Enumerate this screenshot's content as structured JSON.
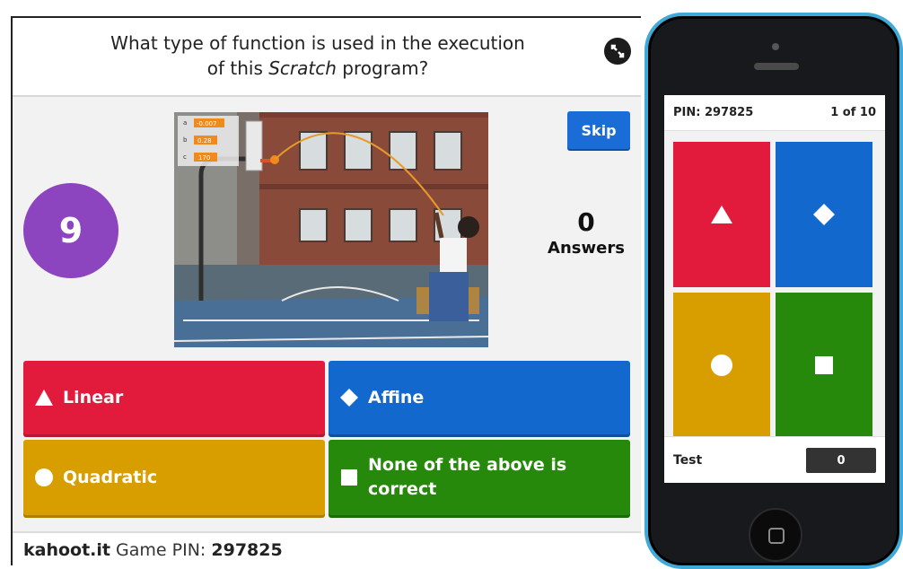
{
  "host": {
    "question": {
      "line1": "What type of function is used in  the execution",
      "line2_before": "of this ",
      "line2_italic": "Scratch",
      "line2_after": " program?"
    },
    "timer": "9",
    "skip_label": "Skip",
    "answers_count": "0",
    "answers_label": "Answers",
    "media_vars": [
      {
        "name": "a",
        "value": "-0.007"
      },
      {
        "name": "b",
        "value": "0.28"
      },
      {
        "name": "c",
        "value": "170"
      }
    ],
    "options": [
      {
        "shape": "triangle",
        "label": "Linear",
        "color": "#e21b3c"
      },
      {
        "shape": "diamond",
        "label": "Affine",
        "color": "#1368ce"
      },
      {
        "shape": "circle",
        "label": "Quadratic",
        "color": "#d89e00"
      },
      {
        "shape": "square",
        "label_line1": "None of the above is",
        "label_line2": "correct",
        "color": "#26890c"
      }
    ],
    "footer": {
      "brand": "kahoot.it",
      "pin_label": "Game PIN:",
      "pin": "297825"
    }
  },
  "phone": {
    "pin": "PIN: 297825",
    "progress": "1 of 10",
    "tiles": [
      {
        "shape": "triangle",
        "color": "#e21b3c"
      },
      {
        "shape": "diamond",
        "color": "#1368ce"
      },
      {
        "shape": "circle",
        "color": "#d89e00"
      },
      {
        "shape": "square",
        "color": "#26890c"
      }
    ],
    "nickname": "Test",
    "score": "0"
  },
  "icons": [
    "fullscreen-icon",
    "triangle-icon",
    "diamond-icon",
    "circle-icon",
    "square-icon",
    "home-button-icon"
  ]
}
